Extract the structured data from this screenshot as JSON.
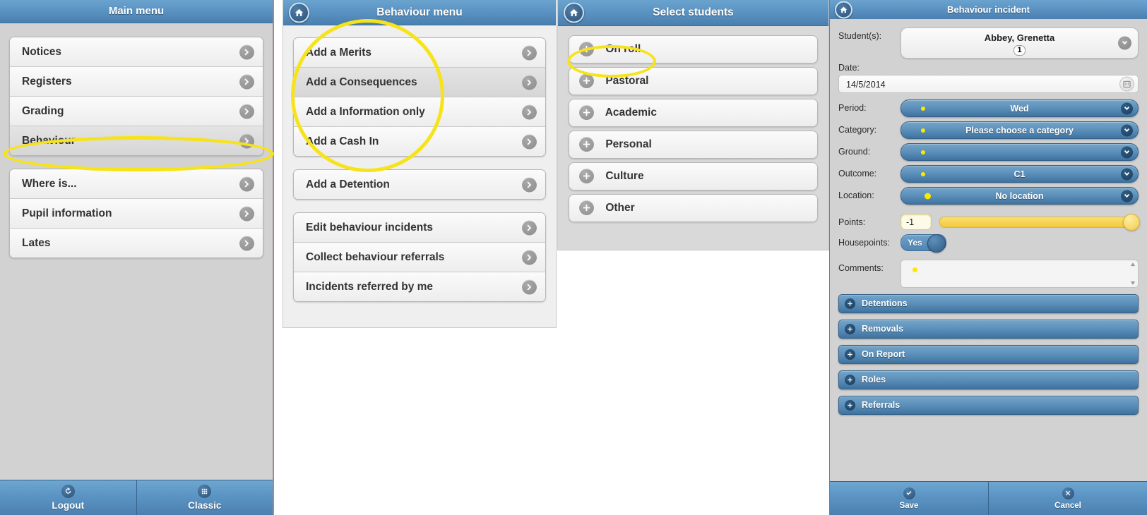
{
  "panels": {
    "main": {
      "title": "Main menu",
      "groups": [
        {
          "items": [
            {
              "label": "Notices",
              "selected": false
            },
            {
              "label": "Registers",
              "selected": false
            },
            {
              "label": "Grading",
              "selected": false
            },
            {
              "label": "Behaviour",
              "selected": true
            }
          ]
        },
        {
          "items": [
            {
              "label": "Where is...",
              "selected": false
            },
            {
              "label": "Pupil information",
              "selected": false
            },
            {
              "label": "Lates",
              "selected": false
            }
          ]
        }
      ],
      "footer": [
        {
          "label": "Logout",
          "icon": "logout-icon"
        },
        {
          "label": "Classic",
          "icon": "grid-icon"
        }
      ]
    },
    "behaviour": {
      "title": "Behaviour menu",
      "home_icon": "home-icon",
      "groups": [
        {
          "items": [
            {
              "label": "Add a Merits",
              "selected": false
            },
            {
              "label": "Add a Consequences",
              "selected": true
            },
            {
              "label": "Add a Information only",
              "selected": false
            },
            {
              "label": "Add a Cash In",
              "selected": false
            }
          ]
        },
        {
          "items": [
            {
              "label": "Add a Detention",
              "selected": false
            }
          ]
        },
        {
          "items": [
            {
              "label": "Edit behaviour incidents",
              "selected": false
            },
            {
              "label": "Collect behaviour referrals",
              "selected": false
            },
            {
              "label": "Incidents referred by me",
              "selected": false
            }
          ]
        }
      ]
    },
    "students": {
      "title": "Select students",
      "home_icon": "home-icon",
      "groups": [
        {
          "items": [
            {
              "label": "On roll"
            }
          ]
        },
        {
          "items": [
            {
              "label": "Pastoral"
            }
          ]
        },
        {
          "items": [
            {
              "label": "Academic"
            }
          ]
        },
        {
          "items": [
            {
              "label": "Personal"
            }
          ]
        },
        {
          "items": [
            {
              "label": "Culture"
            }
          ]
        },
        {
          "items": [
            {
              "label": "Other"
            }
          ]
        }
      ]
    },
    "incident": {
      "title": "Behaviour incident",
      "home_icon": "home-icon",
      "student_label": "Student(s):",
      "student_name": "Abbey, Grenetta",
      "student_count": "1",
      "date_label": "Date:",
      "date_value": "14/5/2014",
      "fields": [
        {
          "label": "Period:",
          "value": "Wed",
          "dot": "small"
        },
        {
          "label": "Category:",
          "value": "Please choose a category",
          "dot": "small"
        },
        {
          "label": "Ground:",
          "value": "",
          "dot": "small"
        },
        {
          "label": "Outcome:",
          "value": "C1",
          "dot": "small"
        },
        {
          "label": "Location:",
          "value": "No location",
          "dot": "big"
        }
      ],
      "points_label": "Points:",
      "points_value": "-1",
      "slider_percent": 100,
      "housepoints_label": "Housepoints:",
      "housepoints_value": "Yes",
      "comments_label": "Comments:",
      "comments_value": "",
      "accordions": [
        {
          "label": "Detentions"
        },
        {
          "label": "Removals"
        },
        {
          "label": "On Report"
        },
        {
          "label": "Roles"
        },
        {
          "label": "Referrals"
        }
      ],
      "footer": [
        {
          "label": "Save",
          "icon": "check-icon"
        },
        {
          "label": "Cancel",
          "icon": "x-icon"
        }
      ]
    }
  },
  "annotations": {
    "accent_color": "#f7e319",
    "highlights": [
      "Behaviour",
      "Add a Merits / Consequences / Information only / Cash In",
      "On roll"
    ]
  }
}
